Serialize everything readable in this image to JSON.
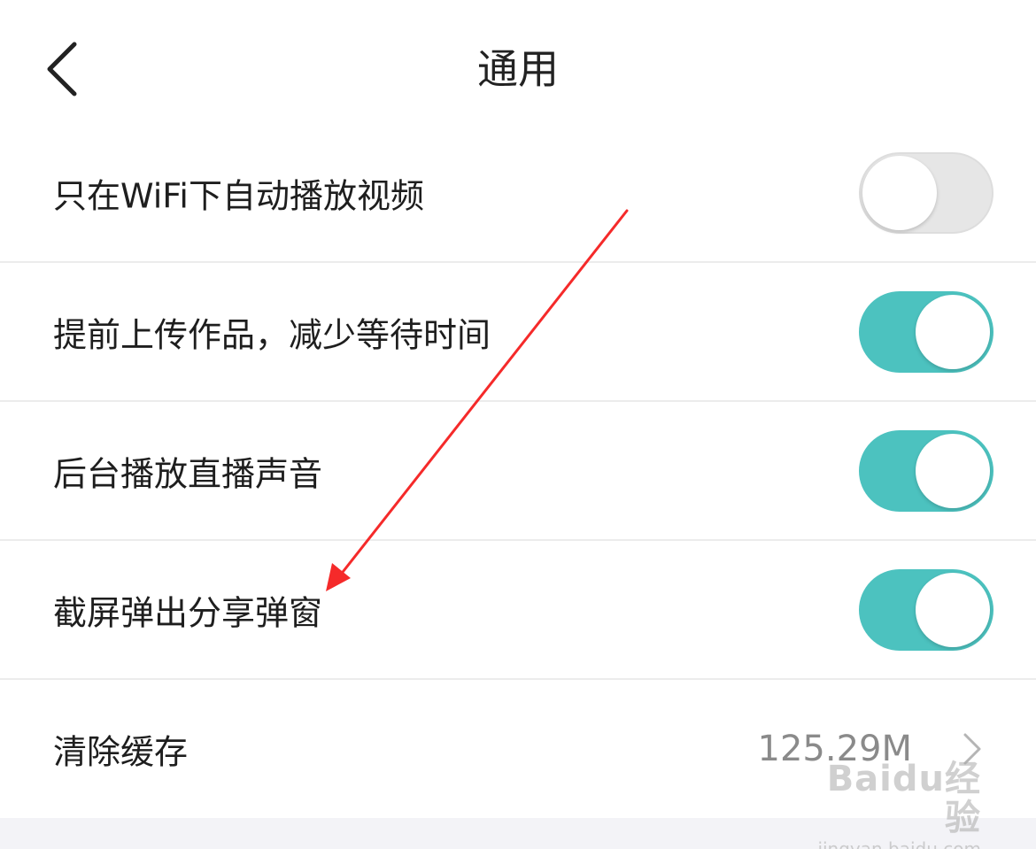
{
  "header": {
    "title": "通用",
    "back_icon": "chevron-left-icon"
  },
  "settings": [
    {
      "label": "只在WiFi下自动播放视频",
      "toggle": "off"
    },
    {
      "label": "提前上传作品，减少等待时间",
      "toggle": "on"
    },
    {
      "label": "后台播放直播声音",
      "toggle": "on"
    },
    {
      "label": "截屏弹出分享弹窗",
      "toggle": "on"
    }
  ],
  "cache": {
    "label": "清除缓存",
    "value": "125.29M"
  },
  "watermark": {
    "logo": "Baidu经验",
    "url": "jingyan.baidu.com"
  },
  "colors": {
    "toggle_on": "#4cc2bf",
    "toggle_off": "#e6e6e6",
    "arrow": "#f52a2a"
  }
}
